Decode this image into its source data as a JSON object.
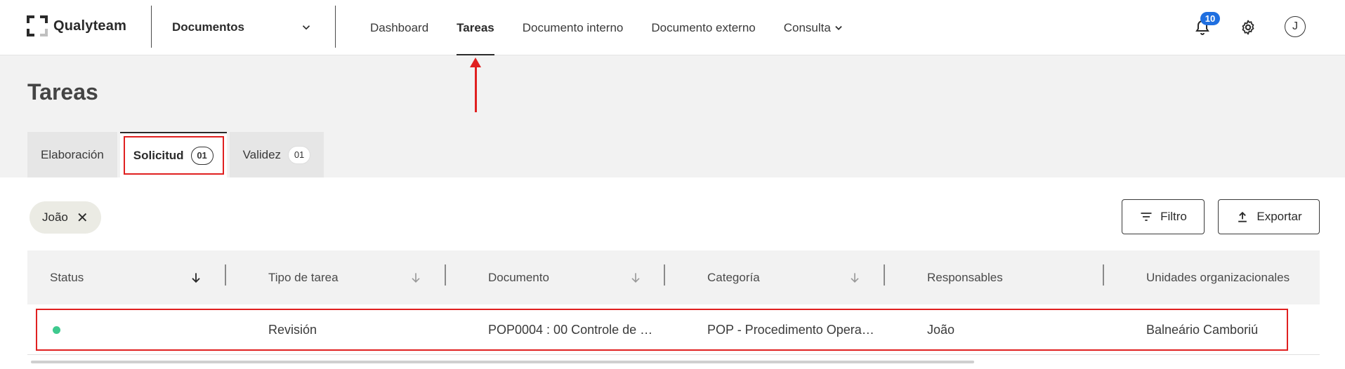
{
  "brand": {
    "name": "Qualyteam"
  },
  "module_select": {
    "value": "Documentos"
  },
  "nav": {
    "items": [
      {
        "label": "Dashboard"
      },
      {
        "label": "Tareas"
      },
      {
        "label": "Documento interno"
      },
      {
        "label": "Documento externo"
      },
      {
        "label": "Consulta"
      }
    ],
    "active": "Tareas"
  },
  "header_icons": {
    "notifications_count": "10",
    "avatar_initial": "J"
  },
  "page": {
    "title": "Tareas"
  },
  "tabs": [
    {
      "label": "Elaboración",
      "count": ""
    },
    {
      "label": "Solicitud",
      "count": "01"
    },
    {
      "label": "Validez",
      "count": "01"
    }
  ],
  "filter_chip": {
    "label": "João"
  },
  "actions": {
    "filter_label": "Filtro",
    "export_label": "Exportar"
  },
  "table": {
    "columns": [
      "Status",
      "Tipo de tarea",
      "Documento",
      "Categoría",
      "Responsables",
      "Unidades organizacionales"
    ],
    "rows": [
      {
        "status": "active",
        "tipo": "Revisión",
        "documento": "POP0004 : 00 Controle de …",
        "categoria": "POP - Procedimento Opera…",
        "responsables": "João",
        "unidades": "Balneário Camboriú"
      }
    ]
  },
  "colors": {
    "accent_blue": "#1f6fe0",
    "status_green": "#3ec98e",
    "annotation_red": "#e02020"
  }
}
